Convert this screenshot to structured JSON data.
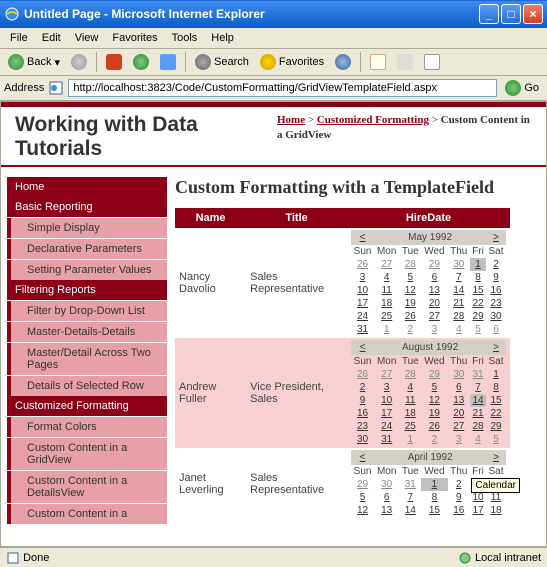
{
  "window": {
    "title": "Untitled Page - Microsoft Internet Explorer"
  },
  "menu": {
    "file": "File",
    "edit": "Edit",
    "view": "View",
    "favorites": "Favorites",
    "tools": "Tools",
    "help": "Help"
  },
  "toolbar": {
    "back": "Back",
    "search": "Search",
    "favorites": "Favorites"
  },
  "address": {
    "label": "Address",
    "url": "http://localhost:3823/Code/CustomFormatting/GridViewTemplateField.aspx",
    "go": "Go"
  },
  "page": {
    "heading": "Working with Data Tutorials",
    "breadcrumb": {
      "home": "Home",
      "sep": ">",
      "section": "Customized Formatting",
      "current": "Custom Content in a GridView"
    },
    "content_title": "Custom Formatting with a TemplateField"
  },
  "nav": {
    "home": "Home",
    "basic": "Basic Reporting",
    "basic_items": [
      "Simple Display",
      "Declarative Parameters",
      "Setting Parameter Values"
    ],
    "filter": "Filtering Reports",
    "filter_items": [
      "Filter by Drop-Down List",
      "Master-Details-Details",
      "Master/Detail Across Two Pages",
      "Details of Selected Row"
    ],
    "custom": "Customized Formatting",
    "custom_items": [
      "Format Colors",
      "Custom Content in a GridView",
      "Custom Content in a DetailsView",
      "Custom Content in a"
    ]
  },
  "grid": {
    "headers": {
      "name": "Name",
      "title": "Title",
      "hiredate": "HireDate"
    },
    "rows": [
      {
        "name": "Nancy Davolio",
        "title": "Sales Representative",
        "cal": "cal1"
      },
      {
        "name": "Andrew Fuller",
        "title": "Vice President, Sales",
        "cal": "cal2"
      },
      {
        "name": "Janet Leverling",
        "title": "Sales Representative",
        "cal": "cal3"
      }
    ]
  },
  "cal_dow": [
    "Sun",
    "Mon",
    "Tue",
    "Wed",
    "Thu",
    "Fri",
    "Sat"
  ],
  "cal_nav": {
    "prev": "<",
    "next": ">"
  },
  "calendars": {
    "cal1": {
      "title": "May 1992",
      "weeks": [
        [
          {
            "d": 26,
            "o": 1
          },
          {
            "d": 27,
            "o": 1
          },
          {
            "d": 28,
            "o": 1
          },
          {
            "d": 29,
            "o": 1
          },
          {
            "d": 30,
            "o": 1
          },
          {
            "d": 1,
            "s": 1
          },
          {
            "d": 2
          }
        ],
        [
          {
            "d": 3
          },
          {
            "d": 4
          },
          {
            "d": 5
          },
          {
            "d": 6
          },
          {
            "d": 7
          },
          {
            "d": 8
          },
          {
            "d": 9
          }
        ],
        [
          {
            "d": 10
          },
          {
            "d": 11
          },
          {
            "d": 12
          },
          {
            "d": 13
          },
          {
            "d": 14
          },
          {
            "d": 15
          },
          {
            "d": 16
          }
        ],
        [
          {
            "d": 17
          },
          {
            "d": 18
          },
          {
            "d": 19
          },
          {
            "d": 20
          },
          {
            "d": 21
          },
          {
            "d": 22
          },
          {
            "d": 23
          }
        ],
        [
          {
            "d": 24
          },
          {
            "d": 25
          },
          {
            "d": 26
          },
          {
            "d": 27
          },
          {
            "d": 28
          },
          {
            "d": 29
          },
          {
            "d": 30
          }
        ],
        [
          {
            "d": 31
          },
          {
            "d": 1,
            "o": 1
          },
          {
            "d": 2,
            "o": 1
          },
          {
            "d": 3,
            "o": 1
          },
          {
            "d": 4,
            "o": 1
          },
          {
            "d": 5,
            "o": 1
          },
          {
            "d": 6,
            "o": 1
          }
        ]
      ]
    },
    "cal2": {
      "title": "August 1992",
      "weeks": [
        [
          {
            "d": 26,
            "o": 1
          },
          {
            "d": 27,
            "o": 1
          },
          {
            "d": 28,
            "o": 1
          },
          {
            "d": 29,
            "o": 1
          },
          {
            "d": 30,
            "o": 1
          },
          {
            "d": 31,
            "o": 1
          },
          {
            "d": 1
          }
        ],
        [
          {
            "d": 2
          },
          {
            "d": 3
          },
          {
            "d": 4
          },
          {
            "d": 5
          },
          {
            "d": 6
          },
          {
            "d": 7
          },
          {
            "d": 8
          }
        ],
        [
          {
            "d": 9
          },
          {
            "d": 10
          },
          {
            "d": 11
          },
          {
            "d": 12
          },
          {
            "d": 13
          },
          {
            "d": 14,
            "s": 1
          },
          {
            "d": 15
          }
        ],
        [
          {
            "d": 16
          },
          {
            "d": 17
          },
          {
            "d": 18
          },
          {
            "d": 19
          },
          {
            "d": 20
          },
          {
            "d": 21
          },
          {
            "d": 22
          }
        ],
        [
          {
            "d": 23
          },
          {
            "d": 24
          },
          {
            "d": 25
          },
          {
            "d": 26
          },
          {
            "d": 27
          },
          {
            "d": 28
          },
          {
            "d": 29
          }
        ],
        [
          {
            "d": 30
          },
          {
            "d": 31
          },
          {
            "d": 1,
            "o": 1
          },
          {
            "d": 2,
            "o": 1
          },
          {
            "d": 3,
            "o": 1
          },
          {
            "d": 4,
            "o": 1
          },
          {
            "d": 5,
            "o": 1
          }
        ]
      ]
    },
    "cal3": {
      "title": "April 1992",
      "weeks": [
        [
          {
            "d": 29,
            "o": 1
          },
          {
            "d": 30,
            "o": 1
          },
          {
            "d": 31,
            "o": 1
          },
          {
            "d": 1,
            "s": 1
          },
          {
            "d": 2
          },
          {
            "d": 3
          },
          {
            "d": 4
          }
        ],
        [
          {
            "d": 5
          },
          {
            "d": 6
          },
          {
            "d": 7
          },
          {
            "d": 8
          },
          {
            "d": 9
          },
          {
            "d": 10
          },
          {
            "d": 11
          }
        ],
        [
          {
            "d": 12
          },
          {
            "d": 13
          },
          {
            "d": 14
          },
          {
            "d": 15
          },
          {
            "d": 16
          },
          {
            "d": 17
          },
          {
            "d": 18
          }
        ]
      ]
    }
  },
  "tooltip": "Calendar",
  "status": {
    "done": "Done",
    "zone": "Local intranet"
  }
}
